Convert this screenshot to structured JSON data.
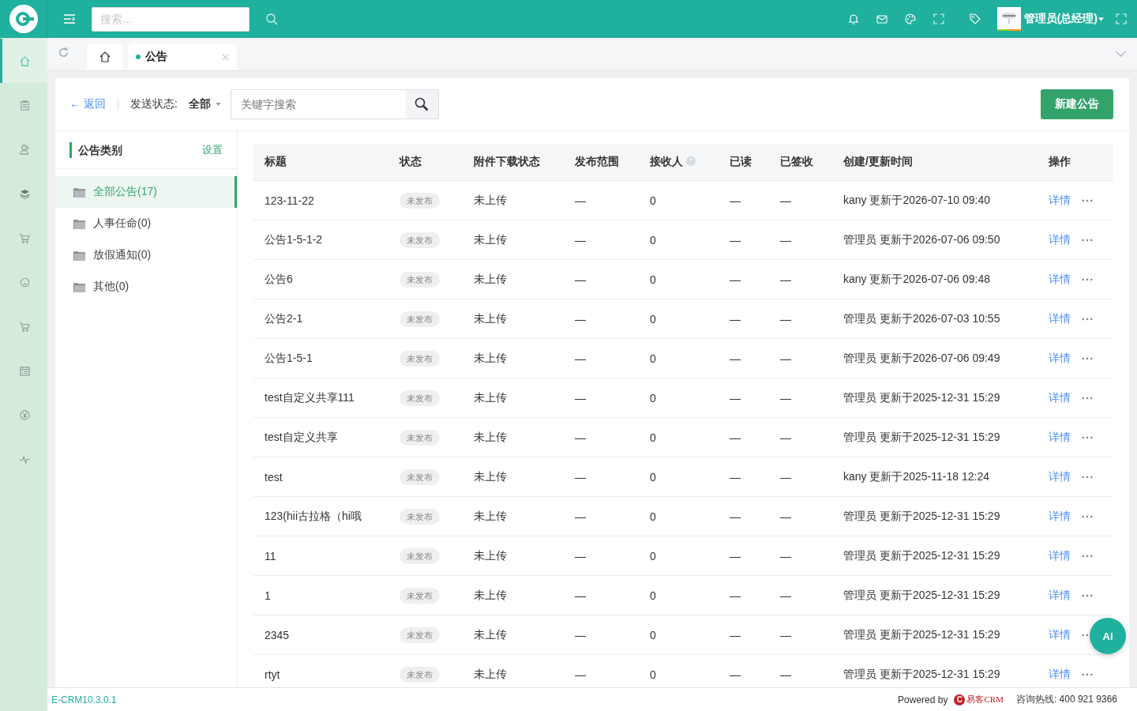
{
  "topbar": {
    "search_placeholder": "搜索...",
    "user": "管理员(总经理)"
  },
  "rail": {
    "items": [
      {
        "selected": true
      },
      {
        "selected": false
      },
      {
        "selected": false
      },
      {
        "selected": false
      },
      {
        "selected": false
      },
      {
        "selected": false
      },
      {
        "selected": false
      },
      {
        "selected": false
      },
      {
        "selected": false
      },
      {
        "selected": false
      }
    ]
  },
  "tabs": [
    {
      "kind": "home",
      "selected": false
    },
    {
      "kind": "page",
      "label": "公告",
      "selected": true
    }
  ],
  "toolbar": {
    "back": "← 返回",
    "filter_label": "发送状态:",
    "filter_value": "全部",
    "search_placeholder": "关键字搜索",
    "new_button": "新建公告"
  },
  "categories": {
    "title": "公告类别",
    "settings": "设置",
    "items": [
      {
        "label": "全部公告(17)",
        "selected": true
      },
      {
        "label": "人事任命(0)",
        "selected": false
      },
      {
        "label": "放假通知(0)",
        "selected": false
      },
      {
        "label": "其他(0)",
        "selected": false
      }
    ]
  },
  "table": {
    "columns": [
      {
        "label": "标题"
      },
      {
        "label": "状态"
      },
      {
        "label": "附件下载状态"
      },
      {
        "label": "发布范围"
      },
      {
        "label": "接收人",
        "help": true
      },
      {
        "label": "已读"
      },
      {
        "label": "已签收"
      },
      {
        "label": "创建/更新时间"
      },
      {
        "label": "操作"
      }
    ],
    "rows": [
      {
        "title": "123-11-22",
        "status": "未发布",
        "attachment": "未上传",
        "scope": "—",
        "receivers": "0",
        "read": "—",
        "signed": "—",
        "time": "kany 更新于2026-07-10 09:40",
        "action": "详情"
      },
      {
        "title": "公告1-5-1-2",
        "status": "未发布",
        "attachment": "未上传",
        "scope": "—",
        "receivers": "0",
        "read": "—",
        "signed": "—",
        "time": "管理员 更新于2026-07-06 09:50",
        "action": "详情"
      },
      {
        "title": "公告6",
        "status": "未发布",
        "attachment": "未上传",
        "scope": "—",
        "receivers": "0",
        "read": "—",
        "signed": "—",
        "time": "kany 更新于2026-07-06 09:48",
        "action": "详情"
      },
      {
        "title": "公告2-1",
        "status": "未发布",
        "attachment": "未上传",
        "scope": "—",
        "receivers": "0",
        "read": "—",
        "signed": "—",
        "time": "管理员 更新于2026-07-03 10:55",
        "action": "详情"
      },
      {
        "title": "公告1-5-1",
        "status": "未发布",
        "attachment": "未上传",
        "scope": "—",
        "receivers": "0",
        "read": "—",
        "signed": "—",
        "time": "管理员 更新于2026-07-06 09:49",
        "action": "详情"
      },
      {
        "title": "test自定义共享111",
        "status": "未发布",
        "attachment": "未上传",
        "scope": "—",
        "receivers": "0",
        "read": "—",
        "signed": "—",
        "time": "管理员 更新于2025-12-31 15:29",
        "action": "详情"
      },
      {
        "title": "test自定义共享",
        "status": "未发布",
        "attachment": "未上传",
        "scope": "—",
        "receivers": "0",
        "read": "—",
        "signed": "—",
        "time": "管理员 更新于2025-12-31 15:29",
        "action": "详情"
      },
      {
        "title": "test",
        "status": "未发布",
        "attachment": "未上传",
        "scope": "—",
        "receivers": "0",
        "read": "—",
        "signed": "—",
        "time": "kany 更新于2025-11-18 12:24",
        "action": "详情"
      },
      {
        "title": "123(hii古拉格（hi哦",
        "status": "未发布",
        "attachment": "未上传",
        "scope": "—",
        "receivers": "0",
        "read": "—",
        "signed": "—",
        "time": "管理员 更新于2025-12-31 15:29",
        "action": "详情"
      },
      {
        "title": "11",
        "status": "未发布",
        "attachment": "未上传",
        "scope": "—",
        "receivers": "0",
        "read": "—",
        "signed": "—",
        "time": "管理员 更新于2025-12-31 15:29",
        "action": "详情"
      },
      {
        "title": "1",
        "status": "未发布",
        "attachment": "未上传",
        "scope": "—",
        "receivers": "0",
        "read": "—",
        "signed": "—",
        "time": "管理员 更新于2025-12-31 15:29",
        "action": "详情"
      },
      {
        "title": "2345",
        "status": "未发布",
        "attachment": "未上传",
        "scope": "—",
        "receivers": "0",
        "read": "—",
        "signed": "—",
        "time": "管理员 更新于2025-12-31 15:29",
        "action": "详情"
      },
      {
        "title": "rtyt",
        "status": "未发布",
        "attachment": "未上传",
        "scope": "—",
        "receivers": "0",
        "read": "—",
        "signed": "—",
        "time": "管理员 更新于2025-12-31 15:29",
        "action": "详情"
      }
    ]
  },
  "ai_button": "AI",
  "footer": {
    "version": "E-CRM10.3.0.1",
    "powered": "Powered by",
    "brand_letter": "C",
    "brand": "易客CRM",
    "hotline": "咨询热线: 400 921 9366"
  }
}
